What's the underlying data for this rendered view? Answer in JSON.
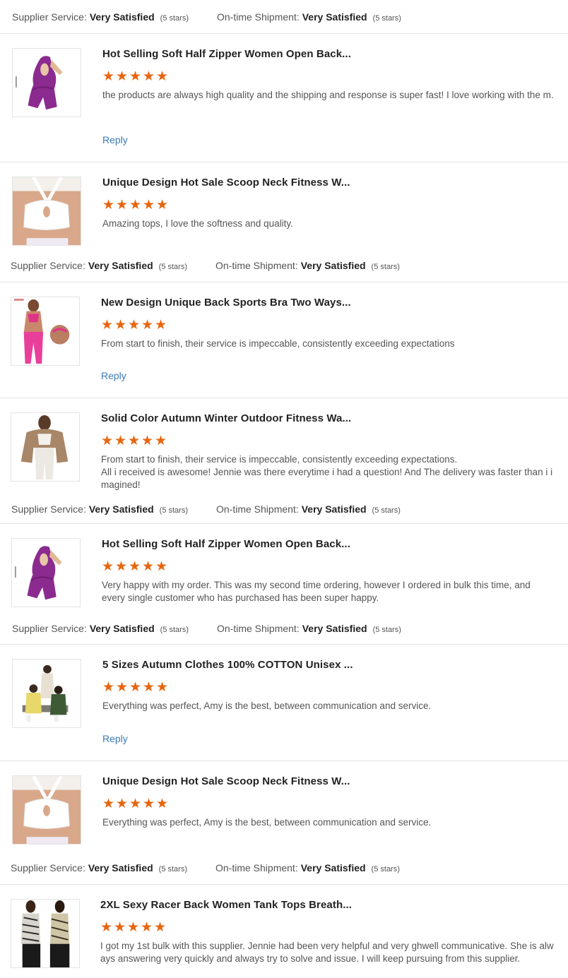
{
  "labels": {
    "supplier_service": "Supplier Service:",
    "ontime_shipment": "On-time Shipment:",
    "reply": "Reply"
  },
  "star_color": "#e8650f",
  "rating_rows": [
    {
      "supplier": "Very Satisfied",
      "supplier_stars": "(5 stars)",
      "shipment": "Very Satisfied",
      "shipment_stars": "(5 stars)"
    },
    {
      "supplier": "Very Satisfied",
      "supplier_stars": "(5 stars)",
      "shipment": "Very Satisfied",
      "shipment_stars": "(5 stars)"
    },
    {
      "supplier": "Very Satisfied",
      "supplier_stars": "(5 stars)",
      "shipment": "Very Satisfied",
      "shipment_stars": "(5 stars)"
    },
    {
      "supplier": "Very Satisfied",
      "supplier_stars": "(5 stars)",
      "shipment": "Very Satisfied",
      "shipment_stars": "(5 stars)"
    },
    {
      "supplier": "Very Satisfied",
      "supplier_stars": "(5 stars)",
      "shipment": "Very Satisfied",
      "shipment_stars": "(5 stars)"
    }
  ],
  "reviews": [
    {
      "title": "Hot Selling Soft Half Zipper Women Open Back...",
      "rating": 5,
      "comment": "the products are always high quality and the shipping and response  is super fast! I love working with the m.",
      "image": "purple-jumpsuit-back"
    },
    {
      "title": "Unique Design Hot Sale Scoop Neck Fitness W...",
      "rating": 5,
      "comment": "Amazing  tops, I love the softness and quality.",
      "image": "white-sports-bra"
    },
    {
      "title": "New Design Unique Back Sports Bra Two Ways...",
      "rating": 5,
      "comment": "From start to finish, their service is impeccable, consistently exceeding expectations",
      "image": "pink-sports-set"
    },
    {
      "title": "Solid Color Autumn Winter Outdoor Fitness Wa...",
      "rating": 5,
      "comment": "From start to finish, their service is impeccable, consistently exceeding expectations.\nAll i received is awesome! Jennie was there everytime i had a question! And The delivery was faster than i i magined!",
      "image": "brown-jacket"
    },
    {
      "title": "Hot Selling Soft Half Zipper Women Open Back...",
      "rating": 5,
      "comment": "Very happy with my order. This was my second time ordering, however I ordered in bulk this time, and every single customer who has purchased has been super happy.",
      "image": "purple-jumpsuit-back"
    },
    {
      "title": "5 Sizes Autumn Clothes 100% COTTON Unisex ...",
      "rating": 5,
      "comment": "Everything was perfect, Amy is the best, between communication and service.",
      "image": "unisex-sweatsuits"
    },
    {
      "title": "Unique Design Hot Sale Scoop Neck Fitness W...",
      "rating": 5,
      "comment": "Everything was perfect, Amy is the best, between communication and service.",
      "image": "white-sports-bra"
    },
    {
      "title": "2XL Sexy Racer Back Women Tank Tops Breath...",
      "rating": 5,
      "comment": "I got my 1st bulk with this supplier. Jennie had been very helpful and very ghwell communicative. She is alw ays answering very quickly and always try to solve and issue. I will keep pursuing from this supplier.",
      "image": "zebra-tank-tops"
    }
  ]
}
